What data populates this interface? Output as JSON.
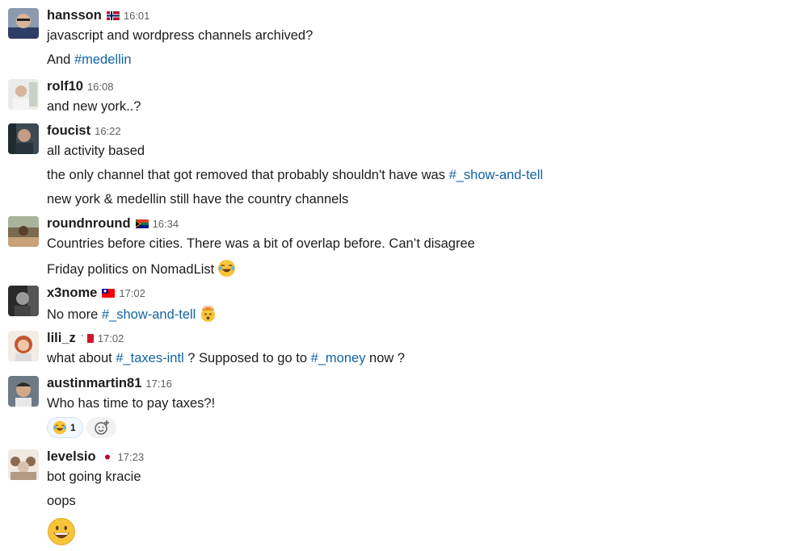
{
  "colors": {
    "link": "#1264a3",
    "text": "#1d1c1d",
    "muted": "#616061",
    "reaction_bg": "#f1f8ff"
  },
  "messages": [
    {
      "user": "hansson",
      "flag": "norway-flag",
      "time": "16:01",
      "lines": [
        "javascript and wordpress channels archived?"
      ],
      "and": "And ",
      "channel": "#medellin"
    },
    {
      "user": "rolf10",
      "time": "16:08",
      "lines": [
        "and new york..?"
      ]
    },
    {
      "user": "foucist",
      "time": "16:22",
      "lines": [
        "all activity based",
        "the only channel that got removed that probably shouldn't have was ",
        "new york & medellin still have the country channels"
      ],
      "channel": "#_show-and-tell"
    },
    {
      "user": "roundnround",
      "flag": "south-africa-flag",
      "time": "16:34",
      "lines": [
        "Countries before cities. There was a bit of overlap before. Can’t disagree",
        "Friday politics on NomadList"
      ],
      "emoji": "joy-emoji"
    },
    {
      "user": "x3nome",
      "flag": "taiwan-flag",
      "time": "17:02",
      "prefix": "No more ",
      "channel": "#_show-and-tell",
      "emoji": "exploding-head-emoji"
    },
    {
      "user": "lili_z",
      "flag": "malta-flag",
      "time": "17:02",
      "parts": [
        "what about ",
        "#_taxes-intl",
        " ? Supposed to go to ",
        "#_money",
        " now ?"
      ]
    },
    {
      "user": "austinmartin81",
      "time": "17:16",
      "lines": [
        "Who has time to pay taxes?!"
      ],
      "reaction": {
        "emoji": "joy-emoji",
        "count": "1"
      }
    },
    {
      "user": "levelsio",
      "flag": "japan-flag",
      "time": "17:23",
      "lines": [
        "bot going kracie",
        "oops"
      ],
      "emoji": "grinning-emoji"
    }
  ]
}
